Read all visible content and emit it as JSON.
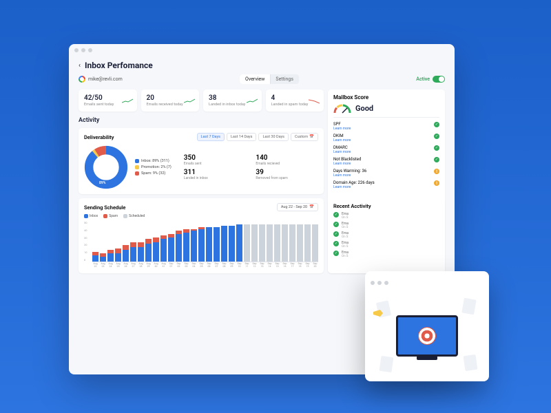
{
  "header": {
    "title": "Inbox Perfomance",
    "email": "mike@revli.com"
  },
  "tabs": {
    "overview": "Overview",
    "settings": "Settings"
  },
  "status": {
    "active": "Active"
  },
  "stats": [
    {
      "value": "42/50",
      "label": "Emails sent today",
      "trend": "up"
    },
    {
      "value": "20",
      "label": "Emails received today",
      "trend": "up"
    },
    {
      "value": "38",
      "label": "Landed in inbox today",
      "trend": "up"
    },
    {
      "value": "4",
      "label": "Landed in spam today",
      "trend": "down"
    }
  ],
  "activity_title": "Activity",
  "deliverability": {
    "title": "Deliverability",
    "ranges": [
      "Last 7 Days",
      "Last 14 Days",
      "Last 30 Days",
      "Custom"
    ],
    "legend": [
      {
        "label": "Inbox: 89% (311)",
        "color": "#2d74e0"
      },
      {
        "label": "Promotion: 2% (7)",
        "color": "#f7c948"
      },
      {
        "label": "Spam: 9% (32)",
        "color": "#e05b49"
      }
    ],
    "donut_labels": {
      "inbox": "89%",
      "spam": "9%"
    },
    "stats": [
      {
        "value": "350",
        "label": "Emails sent"
      },
      {
        "value": "140",
        "label": "Emails recieved"
      },
      {
        "value": "311",
        "label": "Landed in inbox"
      },
      {
        "value": "39",
        "label": "Removed from spam"
      }
    ]
  },
  "mailbox": {
    "title": "Mailbox Score",
    "score": "Good",
    "learn_more": "Learn more",
    "checks": [
      {
        "label": "SPF",
        "status": "ok"
      },
      {
        "label": "DKIM",
        "status": "ok"
      },
      {
        "label": "DMARC",
        "status": "ok"
      },
      {
        "label": "Not Blacklisted",
        "status": "ok"
      },
      {
        "label": "Days Warming: 36",
        "status": "warn"
      },
      {
        "label": "Domain Age: 226 days",
        "status": "warn"
      }
    ]
  },
  "schedule": {
    "title": "Sending Schedule",
    "date_range": "Aug 22 - Sep 20",
    "legend": [
      {
        "label": "Inbox",
        "color": "#2d74e0"
      },
      {
        "label": "Spam",
        "color": "#e05b49"
      },
      {
        "label": "Scheduled",
        "color": "#cdd3da"
      }
    ],
    "ymax": 50,
    "yticks": [
      "50",
      "40",
      "30",
      "20",
      "10",
      "0"
    ]
  },
  "recent": {
    "title": "Recent Acctivity",
    "items": [
      {
        "text": "Ema",
        "sub": "On S",
        "status": "ok"
      },
      {
        "text": "Ema",
        "sub": "On S",
        "status": "ok"
      },
      {
        "text": "Ema",
        "sub": "On S",
        "status": "ok"
      },
      {
        "text": "Ema",
        "sub": "On S",
        "status": "ok"
      },
      {
        "text": "Ema",
        "sub": "On S",
        "status": "ok"
      }
    ]
  },
  "chart_data": {
    "donut": {
      "type": "pie",
      "title": "Deliverability",
      "series": [
        {
          "name": "Inbox",
          "value": 89,
          "count": 311,
          "color": "#2d74e0"
        },
        {
          "name": "Promotion",
          "value": 2,
          "count": 7,
          "color": "#f7c948"
        },
        {
          "name": "Spam",
          "value": 9,
          "count": 32,
          "color": "#e05b49"
        }
      ]
    },
    "schedule": {
      "type": "bar",
      "title": "Sending Schedule",
      "ylabel": "",
      "ylim": [
        0,
        50
      ],
      "categories": [
        "Aug 22",
        "Aug 23",
        "Aug 24",
        "Aug 25",
        "Aug 26",
        "Aug 27",
        "Aug 28",
        "Aug 29",
        "Aug 30",
        "Aug 31",
        "Sep 01",
        "Sep 02",
        "Sep 03",
        "Sep 04",
        "Sep 05",
        "Sep 06",
        "Sep 07",
        "Sep 08",
        "Sep 09",
        "Sep 10",
        "Sep 11",
        "Sep 12",
        "Sep 13",
        "Sep 14",
        "Sep 15",
        "Sep 16",
        "Sep 17",
        "Sep 18",
        "Sep 19",
        "Sep 20"
      ],
      "series": [
        {
          "name": "Inbox",
          "color": "#2d74e0",
          "values": [
            8,
            6,
            10,
            10,
            14,
            18,
            18,
            22,
            24,
            28,
            30,
            34,
            36,
            38,
            40,
            42,
            42,
            44,
            44,
            46,
            0,
            0,
            0,
            0,
            0,
            0,
            0,
            0,
            0,
            0
          ]
        },
        {
          "name": "Spam",
          "color": "#e05b49",
          "values": [
            4,
            4,
            4,
            6,
            6,
            6,
            6,
            6,
            6,
            4,
            4,
            4,
            4,
            2,
            2,
            0,
            0,
            0,
            0,
            0,
            0,
            0,
            0,
            0,
            0,
            0,
            0,
            0,
            0,
            0
          ]
        },
        {
          "name": "Scheduled",
          "color": "#cdd3da",
          "values": [
            0,
            0,
            0,
            0,
            0,
            0,
            0,
            0,
            0,
            0,
            0,
            0,
            0,
            0,
            0,
            0,
            0,
            0,
            0,
            0,
            46,
            46,
            46,
            46,
            46,
            46,
            46,
            46,
            46,
            46
          ]
        }
      ]
    }
  }
}
